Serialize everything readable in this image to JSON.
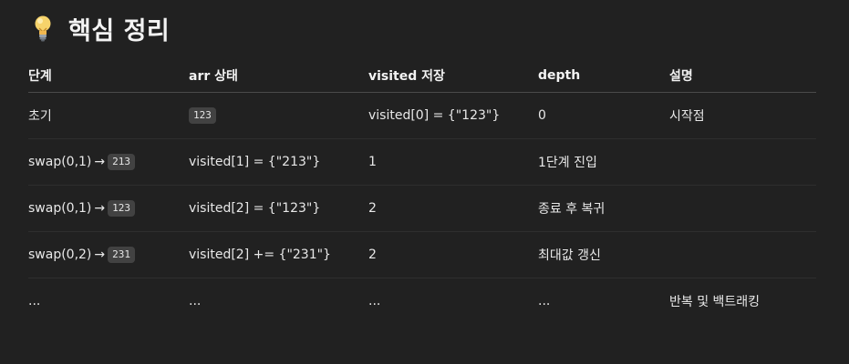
{
  "heading": {
    "icon": "lightbulb-icon",
    "title": "핵심 정리"
  },
  "table": {
    "headers": [
      "단계",
      "arr 상태",
      "visited 저장",
      "depth",
      "설명"
    ],
    "rows": [
      {
        "c1": "초기",
        "c2_code": "123",
        "c3": "visited[0] = {\"123\"}",
        "c4": "0",
        "c5": "시작점"
      },
      {
        "c1_text": "swap(0,1)",
        "c1_arrow": "→",
        "c1_code": "213",
        "c2": "visited[1] = {\"213\"}",
        "c3": "1",
        "c4": "1단계 진입",
        "c5": ""
      },
      {
        "c1_text": "swap(0,1)",
        "c1_arrow": "→",
        "c1_code": "123",
        "c2": "visited[2] = {\"123\"}",
        "c3": "2",
        "c4": "종료 후 복귀",
        "c5": ""
      },
      {
        "c1_text": "swap(0,2)",
        "c1_arrow": "→",
        "c1_code": "231",
        "c2": "visited[2] += {\"231\"}",
        "c3": "2",
        "c4": "최대값 갱신",
        "c5": ""
      },
      {
        "c1": "...",
        "c2": "...",
        "c3": "...",
        "c4": "...",
        "c5": "반복 및 백트래킹"
      }
    ]
  },
  "colors": {
    "background": "#212121",
    "code_bg": "#424242",
    "text": "#ececec"
  }
}
